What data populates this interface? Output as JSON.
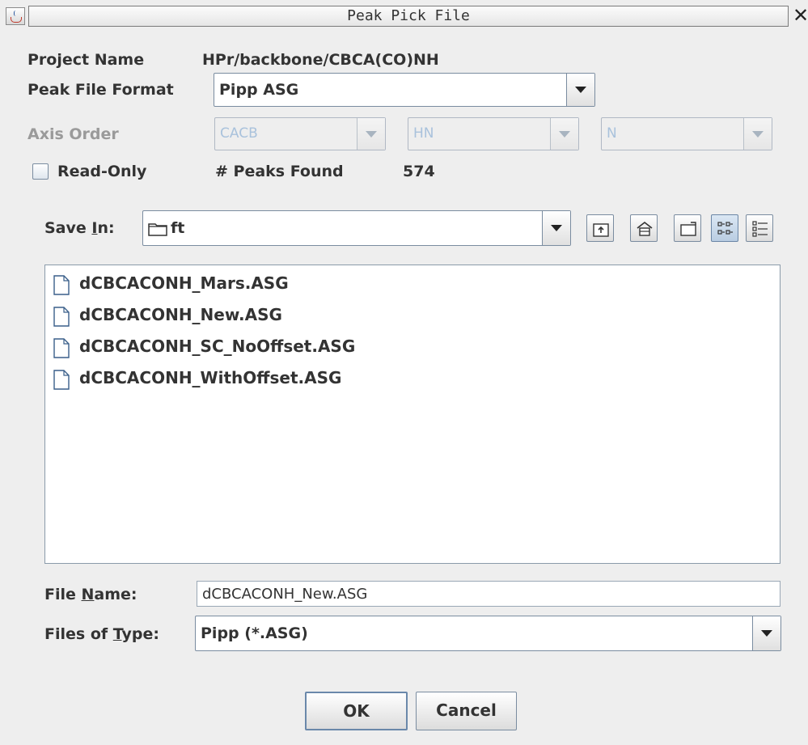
{
  "window": {
    "title": "Peak Pick File",
    "close_glyph": "✕",
    "icon": "java-cup-icon"
  },
  "form": {
    "project_name_label": "Project Name",
    "project_name_value": "HPr/backbone/CBCA(CO)NH",
    "peak_file_format_label": "Peak File Format",
    "peak_file_format_value": "Pipp ASG",
    "axis_order_label": "Axis Order",
    "axis_order": [
      "CACB",
      "HN",
      "N"
    ],
    "read_only_label": "Read-Only",
    "read_only_checked": false,
    "peaks_found_label": "# Peaks Found",
    "peaks_found_value": "574"
  },
  "chooser": {
    "save_in_label_pre": "Save ",
    "save_in_label_mnemonic": "I",
    "save_in_label_post": "n:",
    "save_in_value": "ft",
    "toolbar": [
      "up-folder-icon",
      "home-icon",
      "new-folder-icon",
      "list-view-icon",
      "details-view-icon"
    ],
    "files": [
      "dCBCACONH_Mars.ASG",
      "dCBCACONH_New.ASG",
      "dCBCACONH_SC_NoOffset.ASG",
      "dCBCACONH_WithOffset.ASG"
    ],
    "file_name_label_pre": "File ",
    "file_name_label_mnemonic": "N",
    "file_name_label_post": "ame:",
    "file_name_value": "dCBCACONH_New.ASG",
    "files_of_type_label_pre": "Files of ",
    "files_of_type_label_mnemonic": "T",
    "files_of_type_label_post": "ype:",
    "files_of_type_value": "Pipp (*.ASG)"
  },
  "buttons": {
    "ok": "OK",
    "cancel": "Cancel"
  },
  "colors": {
    "background": "#eeeeee",
    "field_border": "#7a8ca0",
    "disabled_text": "#a9c2dc"
  }
}
